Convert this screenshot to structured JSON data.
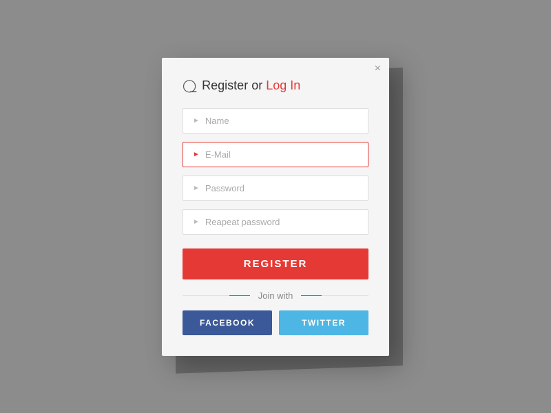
{
  "modal": {
    "title": {
      "register_text": "Register",
      "or_text": "or",
      "login_text": "Log In"
    },
    "close_label": "×",
    "fields": {
      "name": {
        "placeholder": "Name"
      },
      "email": {
        "placeholder": "E-Mail",
        "active": true
      },
      "password": {
        "placeholder": "Password"
      },
      "repeat_password": {
        "placeholder": "Reapeat password"
      }
    },
    "register_button": "REGISTER",
    "join_with": {
      "label": "Join with"
    },
    "facebook_button": "FACEBOOK",
    "twitter_button": "TWITTER"
  },
  "colors": {
    "red": "#e53935",
    "facebook": "#3b5998",
    "twitter": "#4db6e4"
  }
}
